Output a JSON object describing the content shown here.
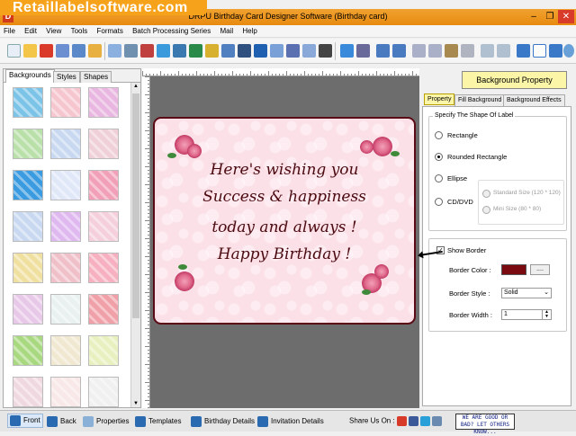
{
  "watermark": "Retaillabelsoftware.com",
  "window": {
    "title": "DRPU Birthday Card Designer Software (Birthday card)",
    "minimize": "–",
    "restore": "❐",
    "close": "✕"
  },
  "menu": [
    "File",
    "Edit",
    "View",
    "Tools",
    "Formats",
    "Batch Processing Series",
    "Mail",
    "Help"
  ],
  "left_panel": {
    "tabs": [
      "Backgrounds",
      "Styles",
      "Shapes"
    ],
    "active_tab": "Backgrounds",
    "thumb_colors": [
      "#7cc3e8",
      "#f6c6cf",
      "#e8b6e0",
      "#b8e0a8",
      "#c8d8f0",
      "#f0d0d8",
      "#3b9be0",
      "#e0e8f8",
      "#f2a0b8",
      "#c8d8f0",
      "#e0b8f0",
      "#f5d0dc",
      "#f0e0a0",
      "#f0c0c8",
      "#f6b0c0",
      "#e8c8e8",
      "#e8f0f0",
      "#f0a0a8",
      "#a8d880",
      "#f0e8d0",
      "#e8f0c0",
      "#f0d8e0",
      "#f8e8e8",
      "#f0f0f0"
    ]
  },
  "card": {
    "lines": [
      "Here's wishing you",
      "Success & happiness",
      "today and always !",
      "Happy Birthday !"
    ],
    "border_color": "#5a0a14",
    "text_color": "#4a0a10"
  },
  "right_panel": {
    "title": "Background Property",
    "tabs": [
      "Property",
      "Fill Background",
      "Background Effects"
    ],
    "active_tab": "Property",
    "shape_group_label": "Specify The Shape Of Label",
    "shapes": [
      {
        "label": "Rectangle",
        "selected": false
      },
      {
        "label": "Rounded Rectangle",
        "selected": true
      },
      {
        "label": "Ellipse",
        "selected": false
      },
      {
        "label": "CD/DVD",
        "selected": false
      }
    ],
    "cd_options": [
      "Standard Size (120 * 120)",
      "Mini Size (80 * 80)"
    ],
    "show_border": {
      "label": "Show Border",
      "checked": true
    },
    "border_color_label": "Border Color :",
    "border_color_button": "....",
    "border_style_label": "Border Style :",
    "border_style_value": "Solid",
    "border_width_label": "Border Width :",
    "border_width_value": "1"
  },
  "statusbar": {
    "items": [
      "Front",
      "Back",
      "Properties",
      "Templates",
      "Birthday Details",
      "Invitation Details"
    ],
    "share_label": "Share Us On :",
    "badge": "WE ARE GOOD OR BAD? LET OTHERS KNOW..."
  }
}
